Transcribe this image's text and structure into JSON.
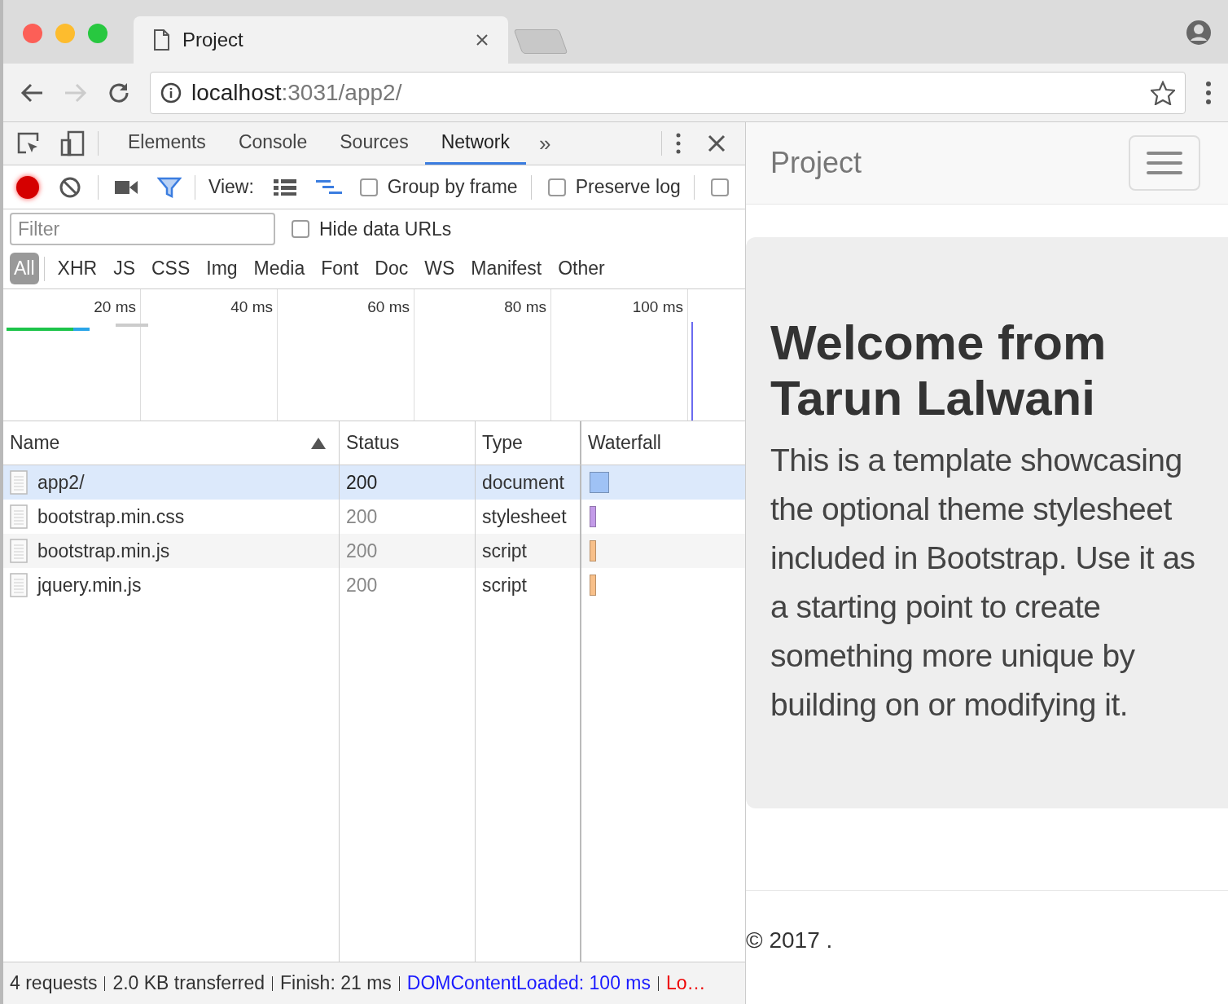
{
  "browser": {
    "tab_title": "Project",
    "url_host": "localhost",
    "url_rest": ":3031/app2/"
  },
  "devtools": {
    "tabs": [
      {
        "label": "Elements",
        "selected": false
      },
      {
        "label": "Console",
        "selected": false
      },
      {
        "label": "Sources",
        "selected": false
      },
      {
        "label": "Network",
        "selected": true
      }
    ],
    "more_tabs": "»",
    "toolbar": {
      "recording": true,
      "filter_active": true,
      "view_label": "View:",
      "checkboxes": [
        {
          "label": "Group by frame",
          "checked": false
        },
        {
          "label": "Preserve log",
          "checked": false
        },
        {
          "checked": false
        }
      ]
    },
    "filter": {
      "placeholder": "Filter",
      "hide_data_urls": {
        "label": "Hide data URLs",
        "checked": false
      }
    },
    "type_filters": [
      {
        "label": "All",
        "selected": true
      },
      {
        "label": "XHR",
        "selected": false
      },
      {
        "label": "JS",
        "selected": false
      },
      {
        "label": "CSS",
        "selected": false
      },
      {
        "label": "Img",
        "selected": false
      },
      {
        "label": "Media",
        "selected": false
      },
      {
        "label": "Font",
        "selected": false
      },
      {
        "label": "Doc",
        "selected": false
      },
      {
        "label": "WS",
        "selected": false
      },
      {
        "label": "Manifest",
        "selected": false
      },
      {
        "label": "Other",
        "selected": false
      }
    ],
    "overview_ticks": [
      "20 ms",
      "40 ms",
      "60 ms",
      "80 ms",
      "100 ms"
    ],
    "columns": [
      {
        "label": "Name",
        "sorted": true
      },
      {
        "label": "Status",
        "sorted": false
      },
      {
        "label": "Type",
        "sorted": false
      },
      {
        "label": "Waterfall",
        "sorted": false
      }
    ],
    "rows": [
      {
        "name": "app2/",
        "status": "200",
        "type": "document",
        "selected": true,
        "color": "#9fc2f5"
      },
      {
        "name": "bootstrap.min.css",
        "status": "200",
        "type": "stylesheet",
        "selected": false,
        "color": "#c39be8"
      },
      {
        "name": "bootstrap.min.js",
        "status": "200",
        "type": "script",
        "selected": false,
        "color": "#f8c08a"
      },
      {
        "name": "jquery.min.js",
        "status": "200",
        "type": "script",
        "selected": false,
        "color": "#f8c08a"
      }
    ],
    "status_bar": [
      {
        "text": "4 requests",
        "kind": "plain"
      },
      {
        "text": "2.0 KB transferred",
        "kind": "plain"
      },
      {
        "text": "Finish: 21 ms",
        "kind": "plain"
      },
      {
        "text": "DOMContentLoaded: 100 ms",
        "kind": "dom"
      },
      {
        "text": "Lo…",
        "kind": "load"
      }
    ]
  },
  "page": {
    "brand": "Project",
    "heading": "Welcome from Tarun Lalwani",
    "lead": "This is a template showcasing the optional theme stylesheet included in Bootstrap. Use it as a starting point to create something more unique by building on or modifying it.",
    "footer": "© 2017 ."
  }
}
